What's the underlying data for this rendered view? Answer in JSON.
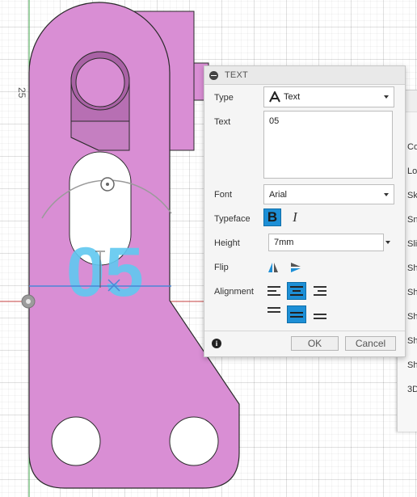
{
  "canvas": {
    "dimension_label": "25",
    "sketch_text_preview": "05",
    "colors": {
      "body": "#d98ed4",
      "body_edge": "#2b2b2b",
      "body_dark": "#b76fb3",
      "text_preview": "#5fc8ef",
      "grid": "#e5e5e5",
      "x_axis": "#c44040",
      "y_axis": "#3ea64a"
    }
  },
  "side_panel": {
    "items": [
      "Co",
      "Lo",
      "Sk",
      "Sn",
      "Sli",
      "Sh",
      "Sh",
      "Sh",
      "Sh",
      "Sh",
      "3D"
    ]
  },
  "dialog": {
    "title": "TEXT",
    "type_label": "Type",
    "type_value": "Text",
    "text_label": "Text",
    "text_value": "05",
    "font_label": "Font",
    "font_value": "Arial",
    "typeface_label": "Typeface",
    "height_label": "Height",
    "height_value": "7mm",
    "flip_label": "Flip",
    "alignment_label": "Alignment",
    "ok_label": "OK",
    "cancel_label": "Cancel",
    "accent_color": "#1d8fd6"
  }
}
